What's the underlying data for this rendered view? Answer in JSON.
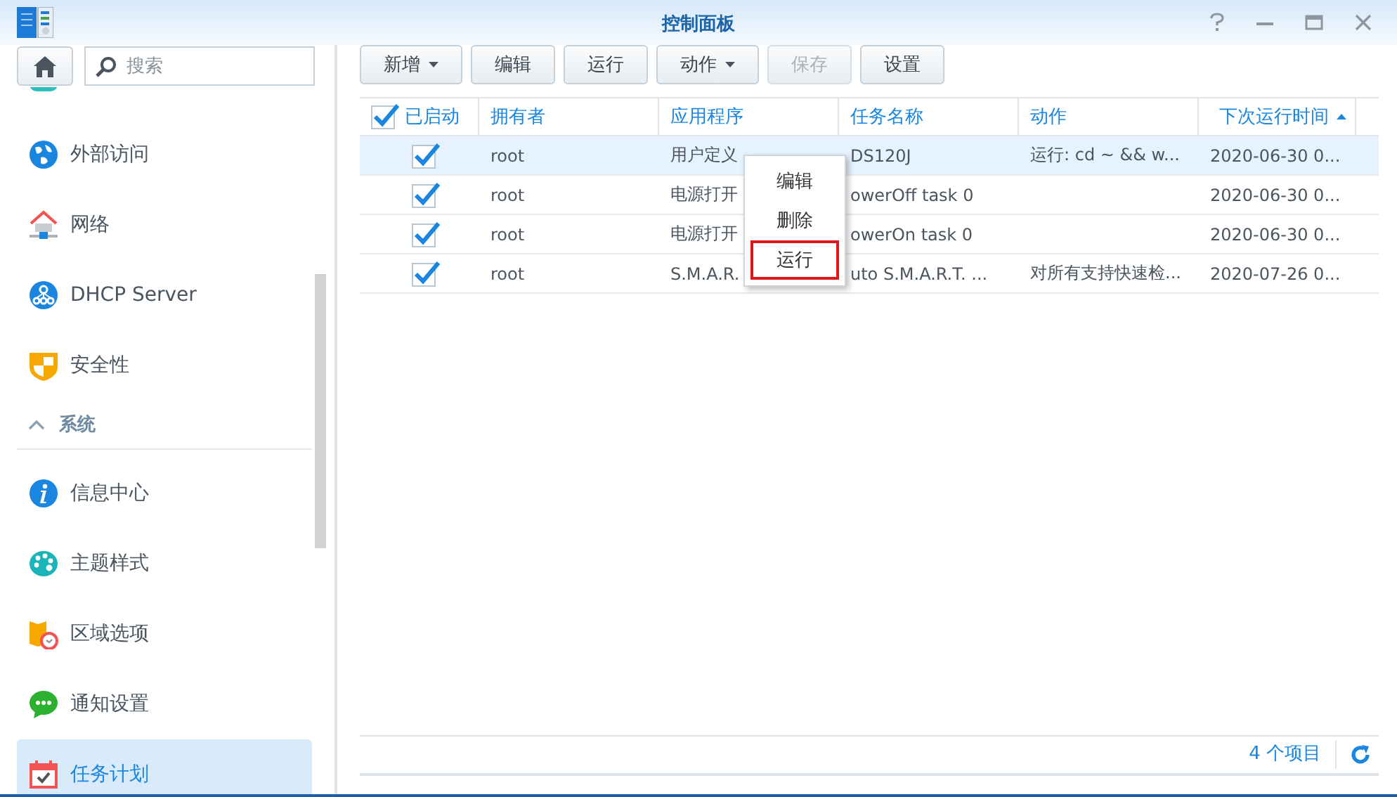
{
  "window": {
    "title": "控制面板"
  },
  "sidebar": {
    "search": {
      "placeholder": "搜索"
    },
    "items": [
      {
        "kind": "clipped"
      },
      {
        "kind": "item",
        "label": "外部访问",
        "selected": false
      },
      {
        "kind": "item",
        "label": "网络",
        "selected": false
      },
      {
        "kind": "item",
        "label": "DHCP Server",
        "selected": false
      },
      {
        "kind": "item",
        "label": "安全性",
        "selected": false
      },
      {
        "kind": "section",
        "label": "系统",
        "expanded": true
      },
      {
        "kind": "item",
        "label": "信息中心",
        "selected": false
      },
      {
        "kind": "item",
        "label": "主题样式",
        "selected": false
      },
      {
        "kind": "item",
        "label": "区域选项",
        "selected": false
      },
      {
        "kind": "item",
        "label": "通知设置",
        "selected": false
      },
      {
        "kind": "item",
        "label": "任务计划",
        "selected": true
      }
    ]
  },
  "toolbar": [
    {
      "label": "新增",
      "dropdown": true,
      "disabled": false
    },
    {
      "label": "编辑",
      "dropdown": false,
      "disabled": false
    },
    {
      "label": "运行",
      "dropdown": false,
      "disabled": false
    },
    {
      "label": "动作",
      "dropdown": true,
      "disabled": false
    },
    {
      "label": "保存",
      "dropdown": false,
      "disabled": true
    },
    {
      "label": "设置",
      "dropdown": false,
      "disabled": false
    }
  ],
  "table": {
    "header_checked": true,
    "columns": [
      {
        "label": "已启动",
        "sorted": false
      },
      {
        "label": "拥有者",
        "sorted": false
      },
      {
        "label": "应用程序",
        "sorted": false
      },
      {
        "label": "任务名称",
        "sorted": false
      },
      {
        "label": "动作",
        "sorted": false
      },
      {
        "label": "下次运行时间",
        "sorted": true
      }
    ],
    "rows": [
      {
        "selected": true,
        "cells": [
          {
            "kind": "check",
            "checked": true
          },
          {
            "kind": "text",
            "text": "root"
          },
          {
            "kind": "text",
            "text": "用户定义"
          },
          {
            "kind": "text",
            "text": "DS120J"
          },
          {
            "kind": "text",
            "text": "运行: cd ~ && w..."
          },
          {
            "kind": "text",
            "text": "2020-06-30 0..."
          }
        ]
      },
      {
        "selected": false,
        "cells": [
          {
            "kind": "check",
            "checked": true
          },
          {
            "kind": "text",
            "text": "root"
          },
          {
            "kind": "text",
            "text": "电源打开"
          },
          {
            "kind": "text",
            "text": "owerOff task 0"
          },
          {
            "kind": "empty"
          },
          {
            "kind": "text",
            "text": "2020-06-30 0..."
          }
        ]
      },
      {
        "selected": false,
        "cells": [
          {
            "kind": "check",
            "checked": true
          },
          {
            "kind": "text",
            "text": "root"
          },
          {
            "kind": "text",
            "text": "电源打开"
          },
          {
            "kind": "text",
            "text": "owerOn task 0"
          },
          {
            "kind": "empty"
          },
          {
            "kind": "text",
            "text": "2020-06-30 0..."
          }
        ]
      },
      {
        "selected": false,
        "cells": [
          {
            "kind": "check",
            "checked": true
          },
          {
            "kind": "text",
            "text": "root"
          },
          {
            "kind": "text",
            "text": "S.M.A.R."
          },
          {
            "kind": "text",
            "text": "uto S.M.A.R.T. ..."
          },
          {
            "kind": "text",
            "text": "对所有支持快速检..."
          },
          {
            "kind": "text",
            "text": "2020-07-26 0..."
          }
        ]
      }
    ]
  },
  "context_menu": [
    {
      "label": "编辑",
      "outlined": false
    },
    {
      "label": "删除",
      "outlined": false
    },
    {
      "label": "运行",
      "outlined": true
    }
  ],
  "footer": {
    "count": "4 个项目"
  }
}
